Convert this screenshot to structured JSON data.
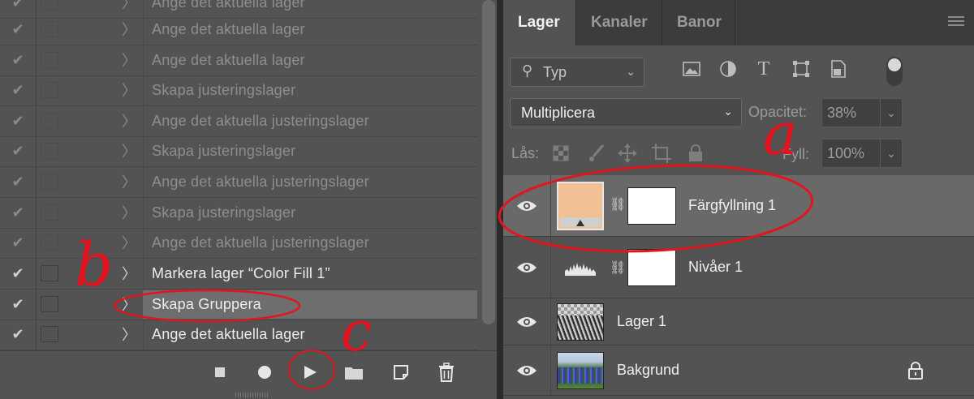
{
  "actions": {
    "items": [
      {
        "label": "Ange det aktuella lager",
        "enabled": true,
        "dim": true
      },
      {
        "label": "Ange det aktuella lager",
        "enabled": true,
        "dim": true
      },
      {
        "label": "Ange det aktuella lager",
        "enabled": true,
        "dim": true
      },
      {
        "label": "Skapa justeringslager",
        "enabled": true,
        "dim": true
      },
      {
        "label": "Ange det aktuella justeringslager",
        "enabled": true,
        "dim": true
      },
      {
        "label": "Skapa justeringslager",
        "enabled": true,
        "dim": true
      },
      {
        "label": "Ange det aktuella justeringslager",
        "enabled": true,
        "dim": true
      },
      {
        "label": "Skapa justeringslager",
        "enabled": true,
        "dim": true
      },
      {
        "label": "Ange det aktuella justeringslager",
        "enabled": true,
        "dim": true
      },
      {
        "label": "Markera lager “Color Fill 1”",
        "enabled": true,
        "dim": false
      },
      {
        "label": "Skapa Gruppera",
        "enabled": true,
        "dim": false,
        "selected": true
      },
      {
        "label": "Ange det aktuella lager",
        "enabled": true,
        "dim": false
      }
    ],
    "toolbar": [
      "stop-icon",
      "record-icon",
      "play-icon",
      "folder-icon",
      "new-action-icon",
      "trash-icon"
    ]
  },
  "layers": {
    "tabs": [
      {
        "label": "Lager",
        "active": true
      },
      {
        "label": "Kanaler",
        "active": false
      },
      {
        "label": "Banor",
        "active": false
      }
    ],
    "filter": {
      "value": "Typ"
    },
    "blend_mode": "Multiplicera",
    "opacity_label": "Opacitet:",
    "opacity_value": "38%",
    "lock_label": "Lås:",
    "fill_label": "Fyll:",
    "fill_value": "100%",
    "rows": [
      {
        "name": "Färgfyllning 1",
        "type": "color-fill",
        "selected": true,
        "fill_color": "#f2c095"
      },
      {
        "name": "Nivåer 1",
        "type": "levels",
        "selected": false
      },
      {
        "name": "Lager 1",
        "type": "pixel",
        "selected": false
      },
      {
        "name": "Bakgrund",
        "type": "background",
        "selected": false,
        "locked": true
      }
    ]
  },
  "annotations": {
    "a": "a",
    "b": "b",
    "c": "c",
    "color": "#e3141e"
  },
  "colors": {
    "panel_bg": "#535353",
    "selected_row": "#696969",
    "tab_bar": "#3c3c3c"
  }
}
